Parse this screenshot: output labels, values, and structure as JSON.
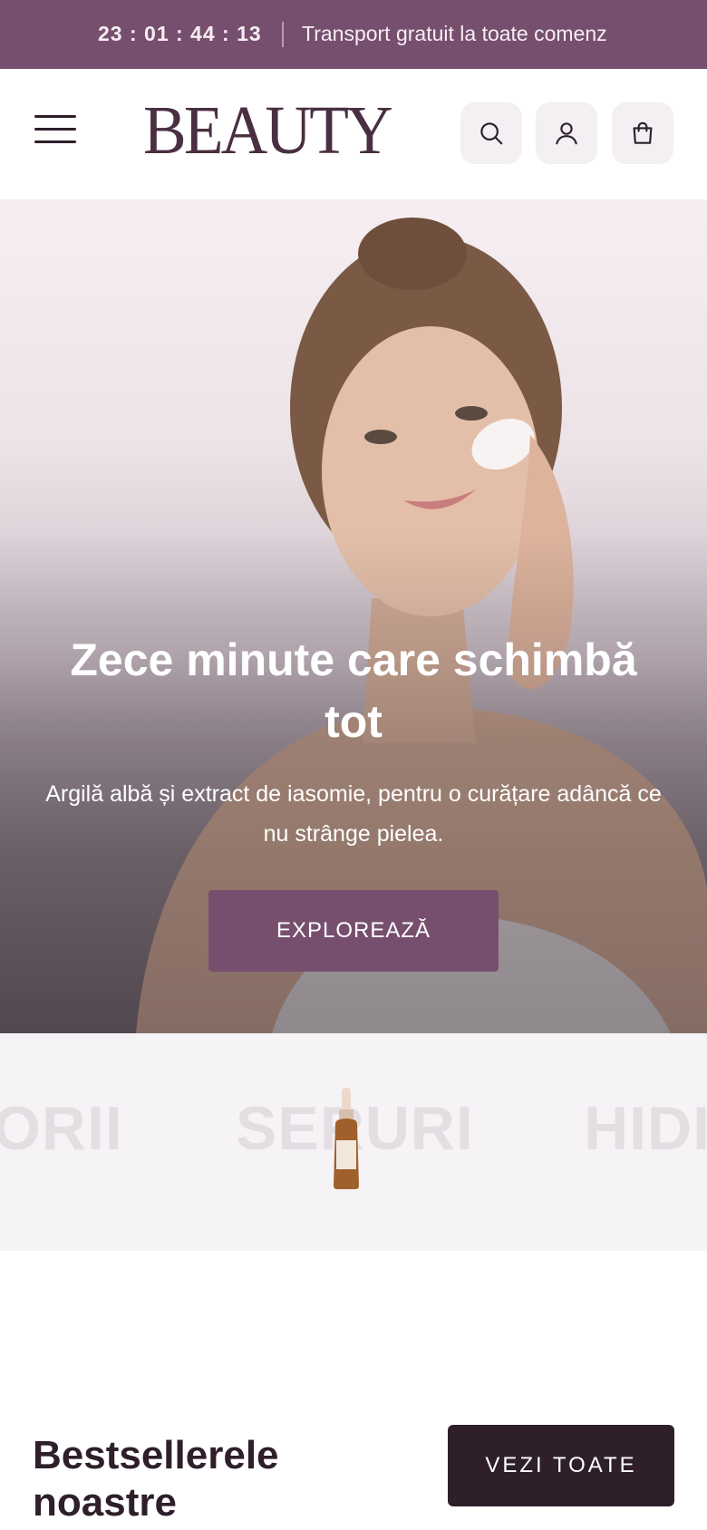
{
  "announcement": {
    "countdown": "23 : 01 : 44 : 13",
    "message": "Transport gratuit la toate comenz"
  },
  "header": {
    "logo": "BEAUTY",
    "icons": [
      "menu-icon",
      "search-icon",
      "user-icon",
      "bag-icon"
    ]
  },
  "hero": {
    "title": "Zece minute care schimbă tot",
    "subtitle": "Argilă albă și extract de iasomie, pentru o curățare adâncă ce nu strânge pielea.",
    "cta_label": "EXPLOREAZĂ"
  },
  "categories": {
    "items": [
      "ORII",
      "SERURI",
      "HIDI"
    ]
  },
  "bestsellers": {
    "title": "Bestsellerele noastre",
    "view_all_label": "VEZI TOATE"
  },
  "colors": {
    "brand": "#774f6e",
    "dark": "#2e1f2b",
    "icon_bg": "#f3eff2"
  }
}
